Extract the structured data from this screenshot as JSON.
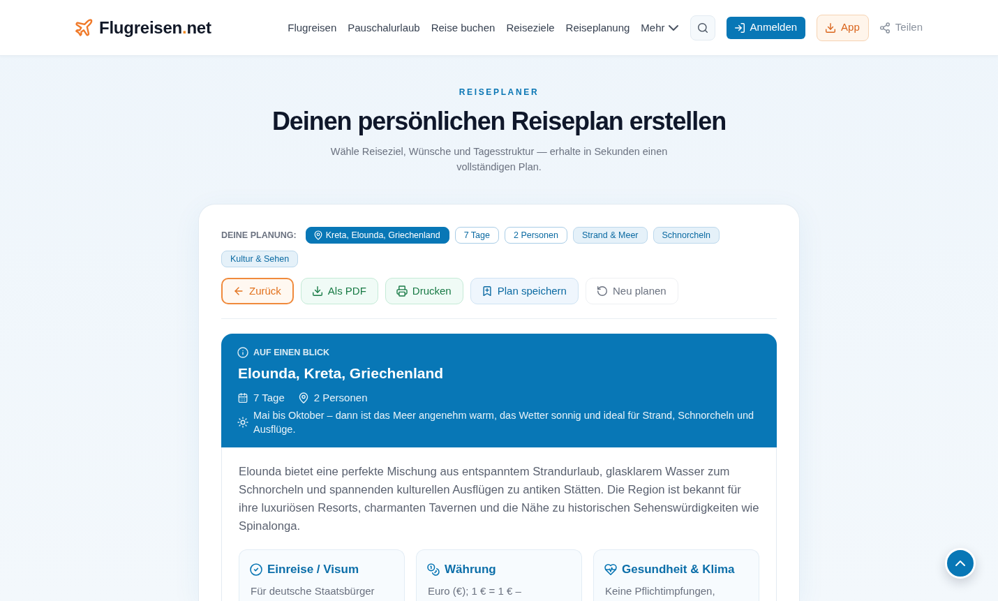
{
  "header": {
    "logo": [
      {
        "text": "Flugreisen",
        "accent": false
      },
      {
        "text": ".",
        "accent": true
      },
      {
        "text": "net",
        "accent": false
      }
    ],
    "nav": [
      {
        "label": "Flugreisen",
        "kind": "link"
      },
      {
        "label": "Pauschalurlaub",
        "kind": "link"
      },
      {
        "label": "Reise buchen",
        "kind": "link"
      },
      {
        "label": "Reiseziele",
        "kind": "link"
      },
      {
        "label": "Reiseplanung",
        "kind": "link"
      },
      {
        "label": "Mehr",
        "kind": "menu"
      }
    ],
    "actions": [
      {
        "label": "Anmelden",
        "kind": "login"
      },
      {
        "label": "App",
        "kind": "app"
      },
      {
        "label": "Teilen",
        "kind": "share"
      }
    ]
  },
  "hero": {
    "eyebrow": "REISEPLANER",
    "title": "Deinen persönlichen Reiseplan erstellen",
    "subtitle": "Wähle Reiseziel, Wünsche und Tagesstruktur — erhalte in Sekunden einen vollständigen Plan."
  },
  "planning": {
    "label": "DEINE PLANUNG:",
    "chips": [
      {
        "label": "Kreta, Elounda, Griechenland",
        "kind": "destination"
      },
      {
        "label": "7 Tage",
        "kind": "fact"
      },
      {
        "label": "2 Personen",
        "kind": "fact"
      },
      {
        "label": "Strand & Meer",
        "kind": "interest"
      },
      {
        "label": "Schnorcheln",
        "kind": "interest"
      },
      {
        "label": "Kultur & Sehen",
        "kind": "interest"
      }
    ]
  },
  "buttons": [
    {
      "label": "Zurück",
      "kind": "back"
    },
    {
      "label": "Als PDF",
      "kind": "pdf"
    },
    {
      "label": "Drucken",
      "kind": "print"
    },
    {
      "label": "Plan speichern",
      "kind": "save"
    },
    {
      "label": "Neu planen",
      "kind": "reset"
    }
  ],
  "overview": {
    "eyebrow": "AUF EINEN BLICK",
    "title": "Elounda, Kreta, Griechenland",
    "facts": [
      {
        "kind": "duration",
        "text": "7 Tage"
      },
      {
        "kind": "travelers",
        "text": "2 Personen"
      }
    ],
    "best_time": "Mai bis Oktober – dann ist das Meer angenehm warm, das Wetter sonnig und ideal für Strand, Schnorcheln und Ausflüge.",
    "intro": "Elounda bietet eine perfekte Mischung aus entspanntem Strandurlaub, glasklarem Wasser zum Schnorcheln und spannenden kulturellen Ausflügen zu antiken Stätten. Die Region ist bekannt für ihre luxuriösen Resorts, charmanten Tavernen und die Nähe zu historischen Sehenswürdigkeiten wie Spinalonga.",
    "info_cards": [
      {
        "kind": "entry",
        "title": "Einreise / Visum",
        "text": "Für deutsche Staatsbürger"
      },
      {
        "kind": "currency",
        "title": "Währung",
        "text": "Euro (€); 1 € = 1 € –"
      },
      {
        "kind": "health",
        "title": "Gesundheit & Klima",
        "text": "Keine Pflichtimpfungen,"
      }
    ]
  }
}
